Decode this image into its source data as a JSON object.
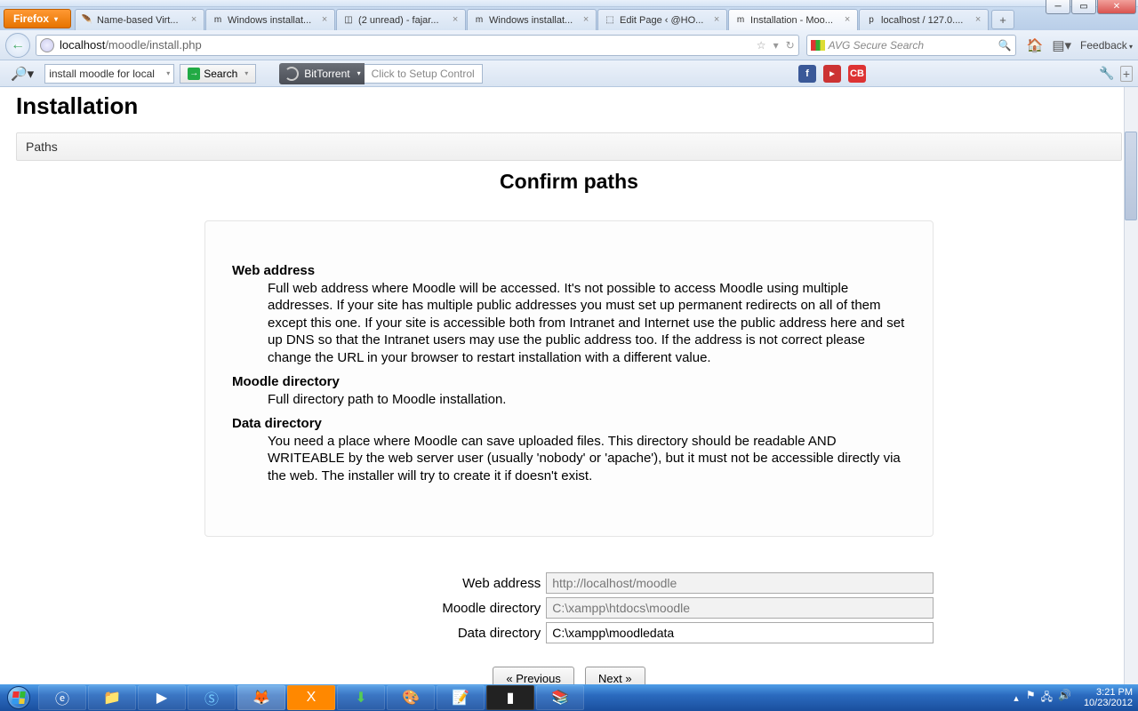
{
  "browser": {
    "firefox_label": "Firefox",
    "url_display_host": "localhost",
    "url_display_path": "/moodle/install.php",
    "search_placeholder": "AVG Secure Search",
    "feedback_label": "Feedback",
    "tabs": [
      {
        "label": "Name-based Virt...",
        "icon": "🪶",
        "active": false
      },
      {
        "label": "Windows installat...",
        "icon": "m",
        "active": false
      },
      {
        "label": "(2 unread) - fajar...",
        "icon": "◫",
        "active": false
      },
      {
        "label": "Windows installat...",
        "icon": "m",
        "active": false
      },
      {
        "label": "Edit Page ‹ @HO...",
        "icon": "⬚",
        "active": false
      },
      {
        "label": "Installation - Moo...",
        "icon": "m",
        "active": true
      },
      {
        "label": "localhost / 127.0....",
        "icon": "p",
        "active": false
      }
    ]
  },
  "toolbar2": {
    "install_field": "install moodle for local",
    "search_label": "Search",
    "bittorrent_label": "BitTorrent",
    "setup_label": "Click to Setup Control"
  },
  "page": {
    "title": "Installation",
    "breadcrumb": "Paths",
    "heading": "Confirm paths",
    "sections": [
      {
        "term": "Web address",
        "desc": "Full web address where Moodle will be accessed. It's not possible to access Moodle using multiple addresses. If your site has multiple public addresses you must set up permanent redirects on all of them except this one. If your site is accessible both from Intranet and Internet use the public address here and set up DNS so that the Intranet users may use the public address too. If the address is not correct please change the URL in your browser to restart installation with a different value."
      },
      {
        "term": "Moodle directory",
        "desc": "Full directory path to Moodle installation."
      },
      {
        "term": "Data directory",
        "desc": "You need a place where Moodle can save uploaded files. This directory should be readable AND WRITEABLE by the web server user (usually 'nobody' or 'apache'), but it must not be accessible directly via the web. The installer will try to create it if doesn't exist."
      }
    ],
    "form": {
      "web_address_label": "Web address",
      "web_address_value": "http://localhost/moodle",
      "moodle_dir_label": "Moodle directory",
      "moodle_dir_value": "C:\\xampp\\htdocs\\moodle",
      "data_dir_label": "Data directory",
      "data_dir_value": "C:\\xampp\\moodledata"
    },
    "buttons": {
      "prev": "« Previous",
      "next": "Next »"
    }
  },
  "taskbar": {
    "time": "3:21 PM",
    "date": "10/23/2012"
  }
}
